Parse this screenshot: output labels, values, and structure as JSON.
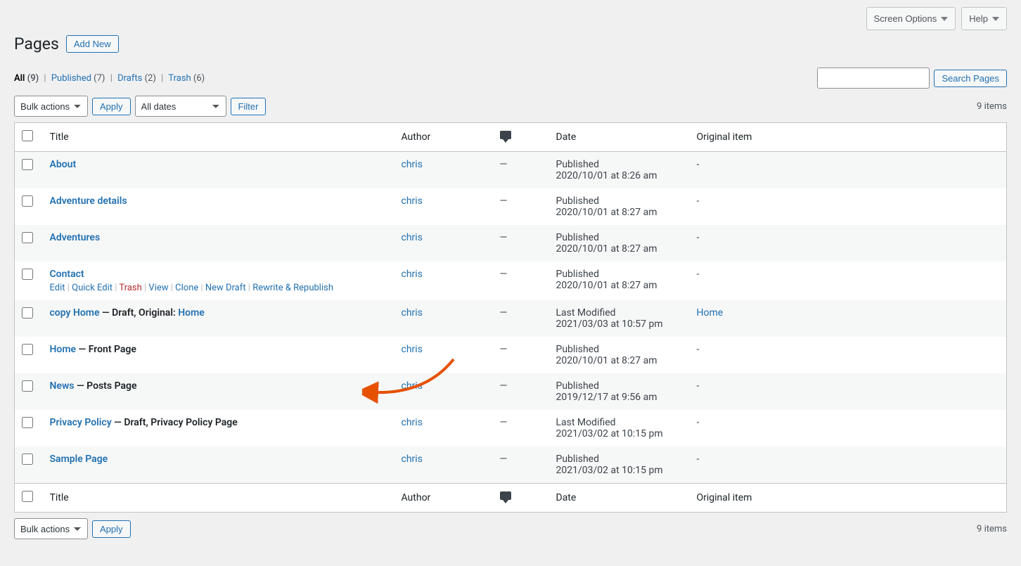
{
  "topbar": {
    "screen_options": "Screen Options",
    "help": "Help"
  },
  "header": {
    "title": "Pages",
    "add_new": "Add New"
  },
  "tabs": {
    "all_label": "All",
    "all_count": "(9)",
    "published_label": "Published",
    "published_count": "(7)",
    "drafts_label": "Drafts",
    "drafts_count": "(2)",
    "trash_label": "Trash",
    "trash_count": "(6)"
  },
  "search": {
    "button": "Search Pages"
  },
  "bulk": {
    "bulk_actions": "Bulk actions",
    "apply": "Apply",
    "all_dates": "All dates",
    "filter": "Filter"
  },
  "count": {
    "items": "9 items"
  },
  "columns": {
    "title": "Title",
    "author": "Author",
    "date": "Date",
    "original": "Original item"
  },
  "row_actions": {
    "edit": "Edit",
    "quick_edit": "Quick Edit",
    "trash": "Trash",
    "view": "View",
    "clone": "Clone",
    "new_draft": "New Draft",
    "rewrite": "Rewrite & Republish"
  },
  "rows": [
    {
      "title": "About",
      "suffix": "",
      "original_link": "",
      "author": "chris",
      "comments": "—",
      "status": "Published",
      "ts": "2020/10/01 at 8:26 am",
      "original": "-",
      "show_actions": false
    },
    {
      "title": "Adventure details",
      "suffix": "",
      "original_link": "",
      "author": "chris",
      "comments": "—",
      "status": "Published",
      "ts": "2020/10/01 at 8:27 am",
      "original": "-",
      "show_actions": false
    },
    {
      "title": "Adventures",
      "suffix": "",
      "original_link": "",
      "author": "chris",
      "comments": "—",
      "status": "Published",
      "ts": "2020/10/01 at 8:27 am",
      "original": "-",
      "show_actions": false
    },
    {
      "title": "Contact",
      "suffix": "",
      "original_link": "",
      "author": "chris",
      "comments": "—",
      "status": "Published",
      "ts": "2020/10/01 at 8:27 am",
      "original": "-",
      "show_actions": true
    },
    {
      "title": "copy Home",
      "suffix": " — Draft, Original: ",
      "original_link": "Home",
      "author": "chris",
      "comments": "—",
      "status": "Last Modified",
      "ts": "2021/03/03 at 10:57 pm",
      "original": "Home",
      "original_is_link": true,
      "show_actions": false
    },
    {
      "title": "Home",
      "suffix": " — Front Page",
      "original_link": "",
      "author": "chris",
      "comments": "—",
      "status": "Published",
      "ts": "2020/10/01 at 8:27 am",
      "original": "-",
      "show_actions": false
    },
    {
      "title": "News",
      "suffix": " — Posts Page",
      "original_link": "",
      "author": "chris",
      "comments": "—",
      "status": "Published",
      "ts": "2019/12/17 at 9:56 am",
      "original": "-",
      "show_actions": false
    },
    {
      "title": "Privacy Policy",
      "suffix": " — Draft, Privacy Policy Page",
      "original_link": "",
      "author": "chris",
      "comments": "—",
      "status": "Last Modified",
      "ts": "2021/03/02 at 10:15 pm",
      "original": "-",
      "show_actions": false
    },
    {
      "title": "Sample Page",
      "suffix": "",
      "original_link": "",
      "author": "chris",
      "comments": "—",
      "status": "Published",
      "ts": "2021/03/02 at 10:15 pm",
      "original": "-",
      "show_actions": false
    }
  ]
}
